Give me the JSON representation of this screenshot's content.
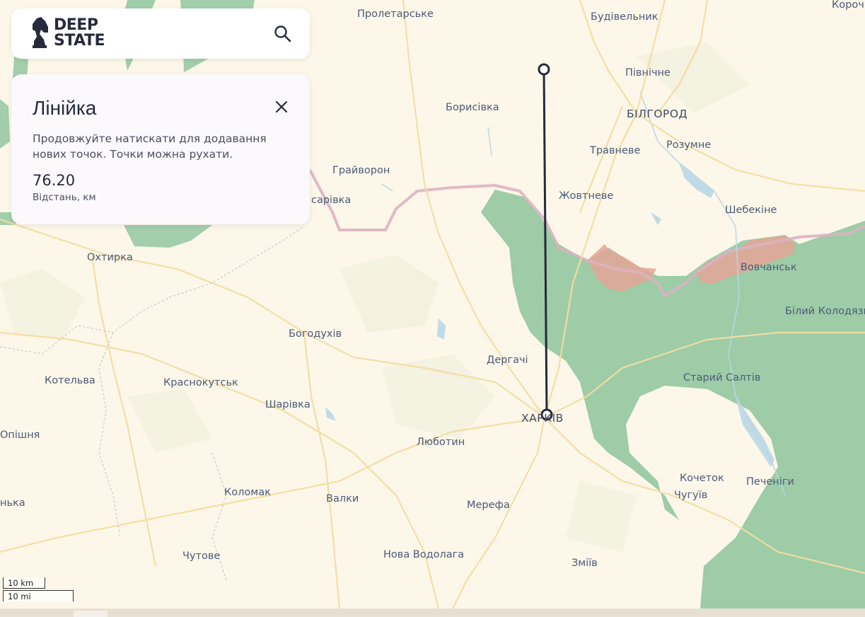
{
  "header": {
    "logo_line1": "DEEP",
    "logo_line2": "STATE"
  },
  "ruler": {
    "title": "Лінійка",
    "hint": "Продовжуйте натискати для додавання нових точок. Точки можна рухати.",
    "distance_value": "76.20",
    "distance_label": "Відстань, км"
  },
  "scale": {
    "km_label": "10 km",
    "mi_label": "10 mi"
  },
  "map": {
    "labels": {
      "proletarske": "Пролетарське",
      "budivelnyk": "Будівельник",
      "korocha": "Короч",
      "pivnichne": "Північне",
      "borysivka": "Борисівка",
      "bilhorod": "БІЛГОРОД",
      "travneve": "Травневе",
      "rozumne": "Розумне",
      "hraivoron": "Грайворон",
      "zhovtneve": "Жовтневе",
      "shebekine": "Шебекіне",
      "sarivka": "сарівка",
      "okhtyrka": "Охтирка",
      "vovchansk": "Вовчанськ",
      "bilyi_kolodiaz": "Білий Колодязь",
      "bohodukhiv": "Богодухів",
      "derhachi": "Дергачі",
      "kotelva": "Котельва",
      "krasnokutsk": "Краснокутськ",
      "staryi_saltiv": "Старий Салтів",
      "sharivka": "Шарівка",
      "kharkiv": "ХАРКІВ",
      "opishnia": "Опішня",
      "liubotyn": "Люботин",
      "kochetok": "Кочеток",
      "pechenihy": "Печеніги",
      "chuhuiv": "Чугуїв",
      "kolomak": "Коломак",
      "valky": "Валки",
      "merefa": "Мерефа",
      "nka": "нька",
      "chutove": "Чутове",
      "nova_vodolaha": "Нова Водолага",
      "zmiiv": "Зміїв"
    },
    "colors": {
      "background": "#fcf7e9",
      "friendly_zone": "#92c7a0",
      "occupied_zone": "#e6a596",
      "border": "#dcb3c1",
      "ruler_line": "#262a3d"
    }
  }
}
